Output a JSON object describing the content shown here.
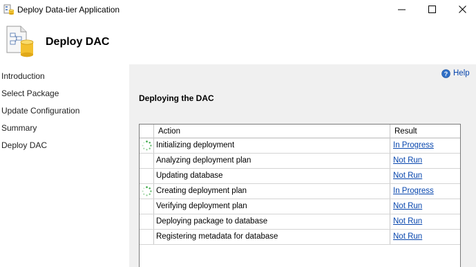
{
  "window": {
    "title": "Deploy Data-tier Application"
  },
  "header": {
    "title": "Deploy DAC"
  },
  "nav": {
    "items": [
      {
        "label": "Introduction"
      },
      {
        "label": "Select Package"
      },
      {
        "label": "Update Configuration"
      },
      {
        "label": "Summary"
      },
      {
        "label": "Deploy DAC"
      }
    ]
  },
  "main": {
    "help_label": "Help",
    "section_title": "Deploying the DAC",
    "table": {
      "columns": [
        "Action",
        "Result"
      ],
      "rows": [
        {
          "action": "Initializing deployment",
          "result": "In Progress",
          "status_icon": "spinner-icon"
        },
        {
          "action": "Analyzing deployment plan",
          "result": "Not Run",
          "status_icon": ""
        },
        {
          "action": "Updating database",
          "result": "Not Run",
          "status_icon": ""
        },
        {
          "action": "Creating deployment plan",
          "result": "In Progress",
          "status_icon": "spinner-icon"
        },
        {
          "action": "Verifying deployment plan",
          "result": "Not Run",
          "status_icon": ""
        },
        {
          "action": "Deploying package to database",
          "result": "Not Run",
          "status_icon": ""
        },
        {
          "action": "Registering metadata for database",
          "result": "Not Run",
          "status_icon": ""
        }
      ]
    }
  },
  "colors": {
    "link": "#0645ad",
    "panel_bg": "#f0f0f0",
    "spinner": "#3aa845"
  }
}
